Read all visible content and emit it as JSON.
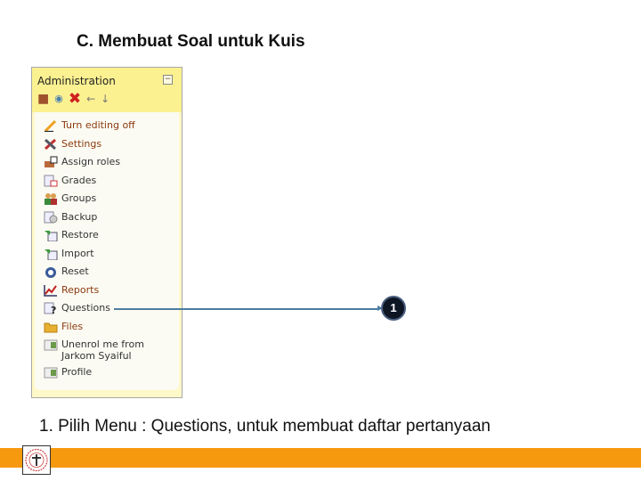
{
  "slide": {
    "title": "C. Membuat Soal untuk Kuis",
    "caption": "1.  Pilih Menu : Questions, untuk membuat daftar pertanyaan",
    "callout_number": "1",
    "accent_color": "#f7990e"
  },
  "admin_block": {
    "title": "Administration",
    "collapse_symbol": "−",
    "header_icons": [
      "assign-roles-icon",
      "eye-icon",
      "delete-icon",
      "move-left-icon",
      "move-down-icon"
    ],
    "items": [
      {
        "label": "Turn editing off",
        "icon": "pencil-icon"
      },
      {
        "label": "Settings",
        "icon": "tools-icon"
      },
      {
        "label": "Assign roles",
        "icon": "assign-roles-icon"
      },
      {
        "label": "Grades",
        "icon": "grades-icon"
      },
      {
        "label": "Groups",
        "icon": "groups-icon"
      },
      {
        "label": "Backup",
        "icon": "backup-icon"
      },
      {
        "label": "Restore",
        "icon": "restore-icon"
      },
      {
        "label": "Import",
        "icon": "import-icon"
      },
      {
        "label": "Reset",
        "icon": "reset-icon"
      },
      {
        "label": "Reports",
        "icon": "reports-icon"
      },
      {
        "label": "Questions",
        "icon": "questions-icon"
      },
      {
        "label": "Files",
        "icon": "folder-icon"
      },
      {
        "label": "Unenrol me from Jarkom Syaiful",
        "icon": "user-card-icon"
      },
      {
        "label": "Profile",
        "icon": "user-card-icon"
      }
    ]
  }
}
